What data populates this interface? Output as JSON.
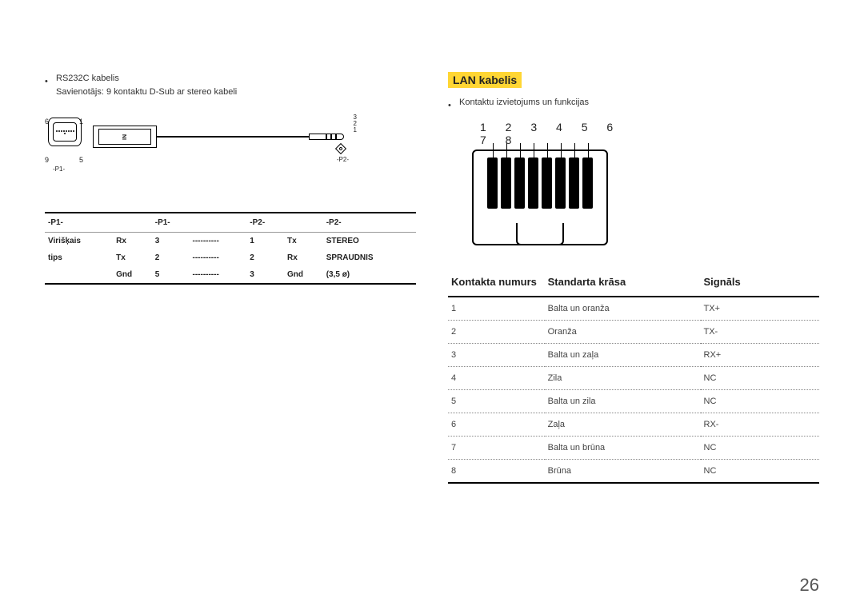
{
  "left": {
    "bullet_title": "RS232C kabelis",
    "bullet_sub": "Savienotājs: 9 kontaktu D-Sub ar stereo kabeli",
    "diag": {
      "l6": "6",
      "l1": "1",
      "l9": "9",
      "l5": "5",
      "p1": "-P1-",
      "p2": "-P2-",
      "in": "IN",
      "n3": "3",
      "n2": "2",
      "n1": "1"
    },
    "table": {
      "h1": "-P1-",
      "h2": "-P1-",
      "h3": "-P2-",
      "h4": "-P2-",
      "r1c0": "Virišķais",
      "r1c1": "Rx",
      "r1c2": "3",
      "r1c3": "----------",
      "r1c4": "1",
      "r1c5": "Tx",
      "r1c6": "STEREO",
      "r2c0": "tips",
      "r2c1": "Tx",
      "r2c2": "2",
      "r2c3": "----------",
      "r2c4": "2",
      "r2c5": "Rx",
      "r2c6": "SPRAUDNIS",
      "r3c0": "",
      "r3c1": "Gnd",
      "r3c2": "5",
      "r3c3": "----------",
      "r3c4": "3",
      "r3c5": "Gnd",
      "r3c6": "(3,5 ø)"
    }
  },
  "right": {
    "heading": "LAN kabelis",
    "bullet": "Kontaktu izvietojums un funkcijas",
    "pins": "1 2 3 4 5 6 7 8",
    "table": {
      "h1": "Kontakta numurs",
      "h2": "Standarta krāsa",
      "h3": "Signāls",
      "rows": [
        {
          "n": "1",
          "c": "Balta un oranža",
          "s": "TX+"
        },
        {
          "n": "2",
          "c": "Oranža",
          "s": "TX-"
        },
        {
          "n": "3",
          "c": "Balta un zaļa",
          "s": "RX+"
        },
        {
          "n": "4",
          "c": "Zila",
          "s": "NC"
        },
        {
          "n": "5",
          "c": "Balta un zila",
          "s": "NC"
        },
        {
          "n": "6",
          "c": "Zaļa",
          "s": "RX-"
        },
        {
          "n": "7",
          "c": "Balta un brūna",
          "s": "NC"
        },
        {
          "n": "8",
          "c": "Brūna",
          "s": "NC"
        }
      ]
    }
  },
  "page": "26"
}
